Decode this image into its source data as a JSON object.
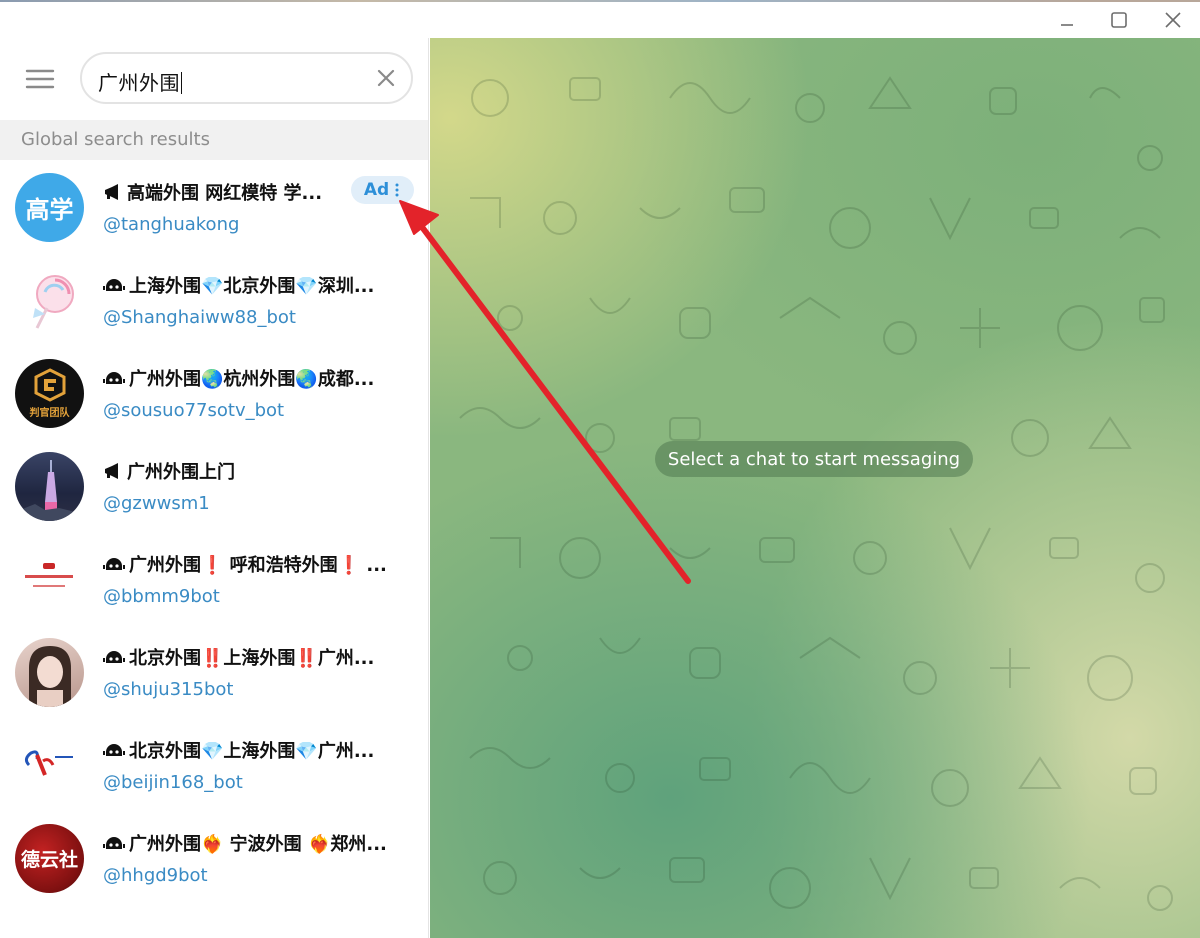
{
  "search": {
    "query": "广州外围"
  },
  "section": {
    "title": "Global search results"
  },
  "ad": {
    "label": "Ad"
  },
  "results": [
    {
      "title": "高端外围 网红模特 学...",
      "handle": "@tanghuakong",
      "kind": "channel",
      "avatar_text": "高学",
      "avatar_color": "#3fa9e8"
    },
    {
      "title": "上海外围💎北京外围💎深圳...",
      "handle": "@Shanghaiww88_bot",
      "kind": "bot",
      "avatar_text": "",
      "avatar_color": "#fde8ee"
    },
    {
      "title": "广州外围🌏杭州外围🌏成都...",
      "handle": "@sousuo77sotv_bot",
      "kind": "bot",
      "avatar_text": "判官团队",
      "avatar_color": "#111111"
    },
    {
      "title": "广州外围上门",
      "handle": "@gzwwsm1",
      "kind": "channel",
      "avatar_text": "",
      "avatar_color": "#27304f"
    },
    {
      "title": "广州外围❗ 呼和浩特外围❗ ...",
      "handle": "@bbmm9bot",
      "kind": "bot",
      "avatar_text": "",
      "avatar_color": "#ffffff"
    },
    {
      "title": "北京外围‼️上海外围‼️广州...",
      "handle": "@shuju315bot",
      "kind": "bot",
      "avatar_text": "",
      "avatar_color": "#c9a79a"
    },
    {
      "title": "北京外围💎上海外围💎广州...",
      "handle": "@beijin168_bot",
      "kind": "bot",
      "avatar_text": "",
      "avatar_color": "#ffffff"
    },
    {
      "title": "广州外围❤️‍🔥 宁波外围 ❤️‍🔥郑州...",
      "handle": "@hhgd9bot",
      "kind": "bot",
      "avatar_text": "德云社",
      "avatar_color": "#b01c1c"
    }
  ],
  "chat": {
    "empty_message": "Select a chat to start messaging"
  },
  "colors": {
    "accent": "#3a8bc4",
    "annotation_arrow": "#e3232a"
  }
}
